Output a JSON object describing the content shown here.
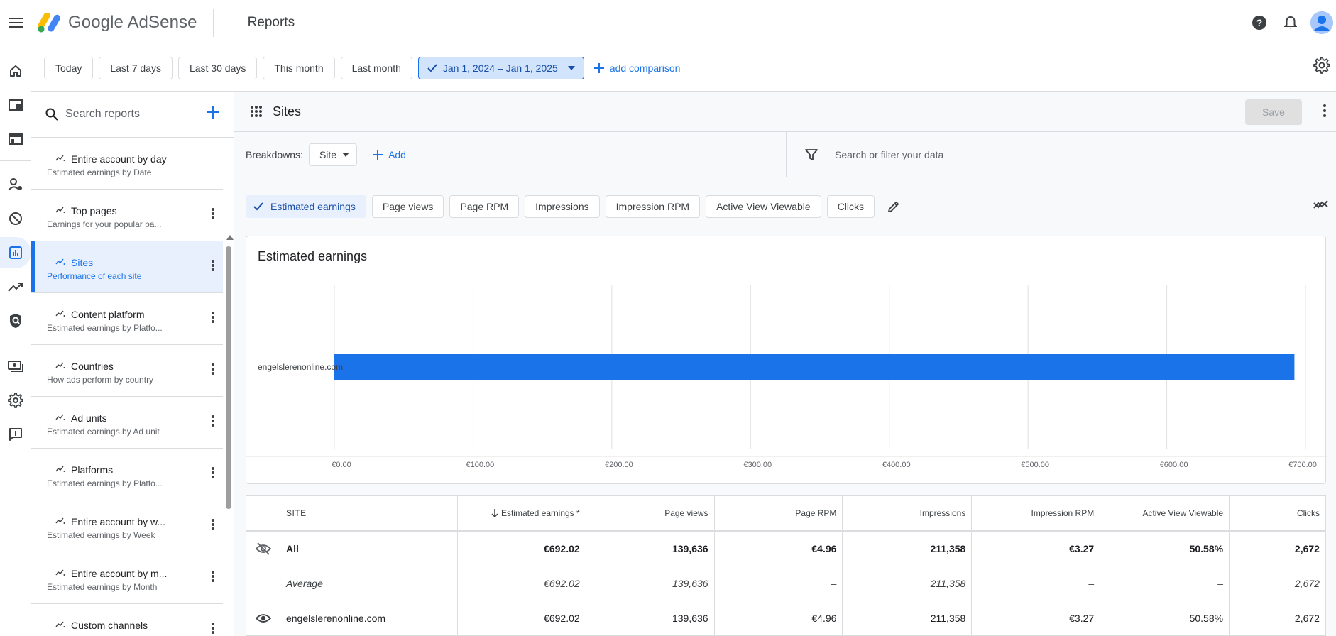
{
  "header": {
    "product_name_google": "Google",
    "product_name_adsense": "AdSense",
    "page_title": "Reports"
  },
  "date_filters": {
    "presets": [
      "Today",
      "Last 7 days",
      "Last 30 days",
      "This month",
      "Last month"
    ],
    "selected_range": "Jan 1, 2024 – Jan 1, 2025",
    "add_comparison": "add comparison"
  },
  "reports_panel": {
    "search_placeholder": "Search reports",
    "items": [
      {
        "title": "Entire account by day",
        "subtitle": "Estimated earnings by Date"
      },
      {
        "title": "Top pages",
        "subtitle": "Earnings for your popular pa..."
      },
      {
        "title": "Sites",
        "subtitle": "Performance of each site"
      },
      {
        "title": "Content platform",
        "subtitle": "Estimated earnings by Platfo..."
      },
      {
        "title": "Countries",
        "subtitle": "How ads perform by country"
      },
      {
        "title": "Ad units",
        "subtitle": "Estimated earnings by Ad unit"
      },
      {
        "title": "Platforms",
        "subtitle": "Estimated earnings by Platfo..."
      },
      {
        "title": "Entire account by w...",
        "subtitle": "Estimated earnings by Week"
      },
      {
        "title": "Entire account by m...",
        "subtitle": "Estimated earnings by Month"
      },
      {
        "title": "Custom channels",
        "subtitle": ""
      }
    ],
    "active_index": 2
  },
  "report": {
    "title": "Sites",
    "save_label": "Save",
    "breakdowns_label": "Breakdowns:",
    "breakdown_value": "Site",
    "add_label": "Add",
    "filter_placeholder": "Search or filter your data"
  },
  "metrics": [
    "Estimated earnings",
    "Page views",
    "Page RPM",
    "Impressions",
    "Impression RPM",
    "Active View Viewable",
    "Clicks"
  ],
  "active_metric": "Estimated earnings",
  "chart_data": {
    "type": "bar",
    "orientation": "horizontal",
    "title": "Estimated earnings",
    "categories": [
      "engelslerenonline.com"
    ],
    "values": [
      692.02
    ],
    "xlim": [
      0,
      700
    ],
    "xticks": [
      0,
      100,
      200,
      300,
      400,
      500,
      600,
      700
    ],
    "xtick_labels": [
      "€0.00",
      "€100.00",
      "€200.00",
      "€300.00",
      "€400.00",
      "€500.00",
      "€600.00",
      "€700.00"
    ],
    "bar_color": "#1a73e8",
    "grid": true
  },
  "table": {
    "columns": [
      "SITE",
      "Estimated earnings *",
      "Page views",
      "Page RPM",
      "Impressions",
      "Impression RPM",
      "Active View Viewable",
      "Clicks"
    ],
    "rows": [
      {
        "label": "All",
        "values": [
          "€692.02",
          "139,636",
          "€4.96",
          "211,358",
          "€3.27",
          "50.58%",
          "2,672"
        ]
      },
      {
        "label": "Average",
        "values": [
          "€692.02",
          "139,636",
          "–",
          "211,358",
          "–",
          "–",
          "2,672"
        ]
      },
      {
        "label": "engelslerenonline.com",
        "values": [
          "€692.02",
          "139,636",
          "€4.96",
          "211,358",
          "€3.27",
          "50.58%",
          "2,672"
        ]
      }
    ]
  },
  "colors": {
    "accent": "#1a73e8",
    "selected_bg": "#e8f0fe"
  }
}
